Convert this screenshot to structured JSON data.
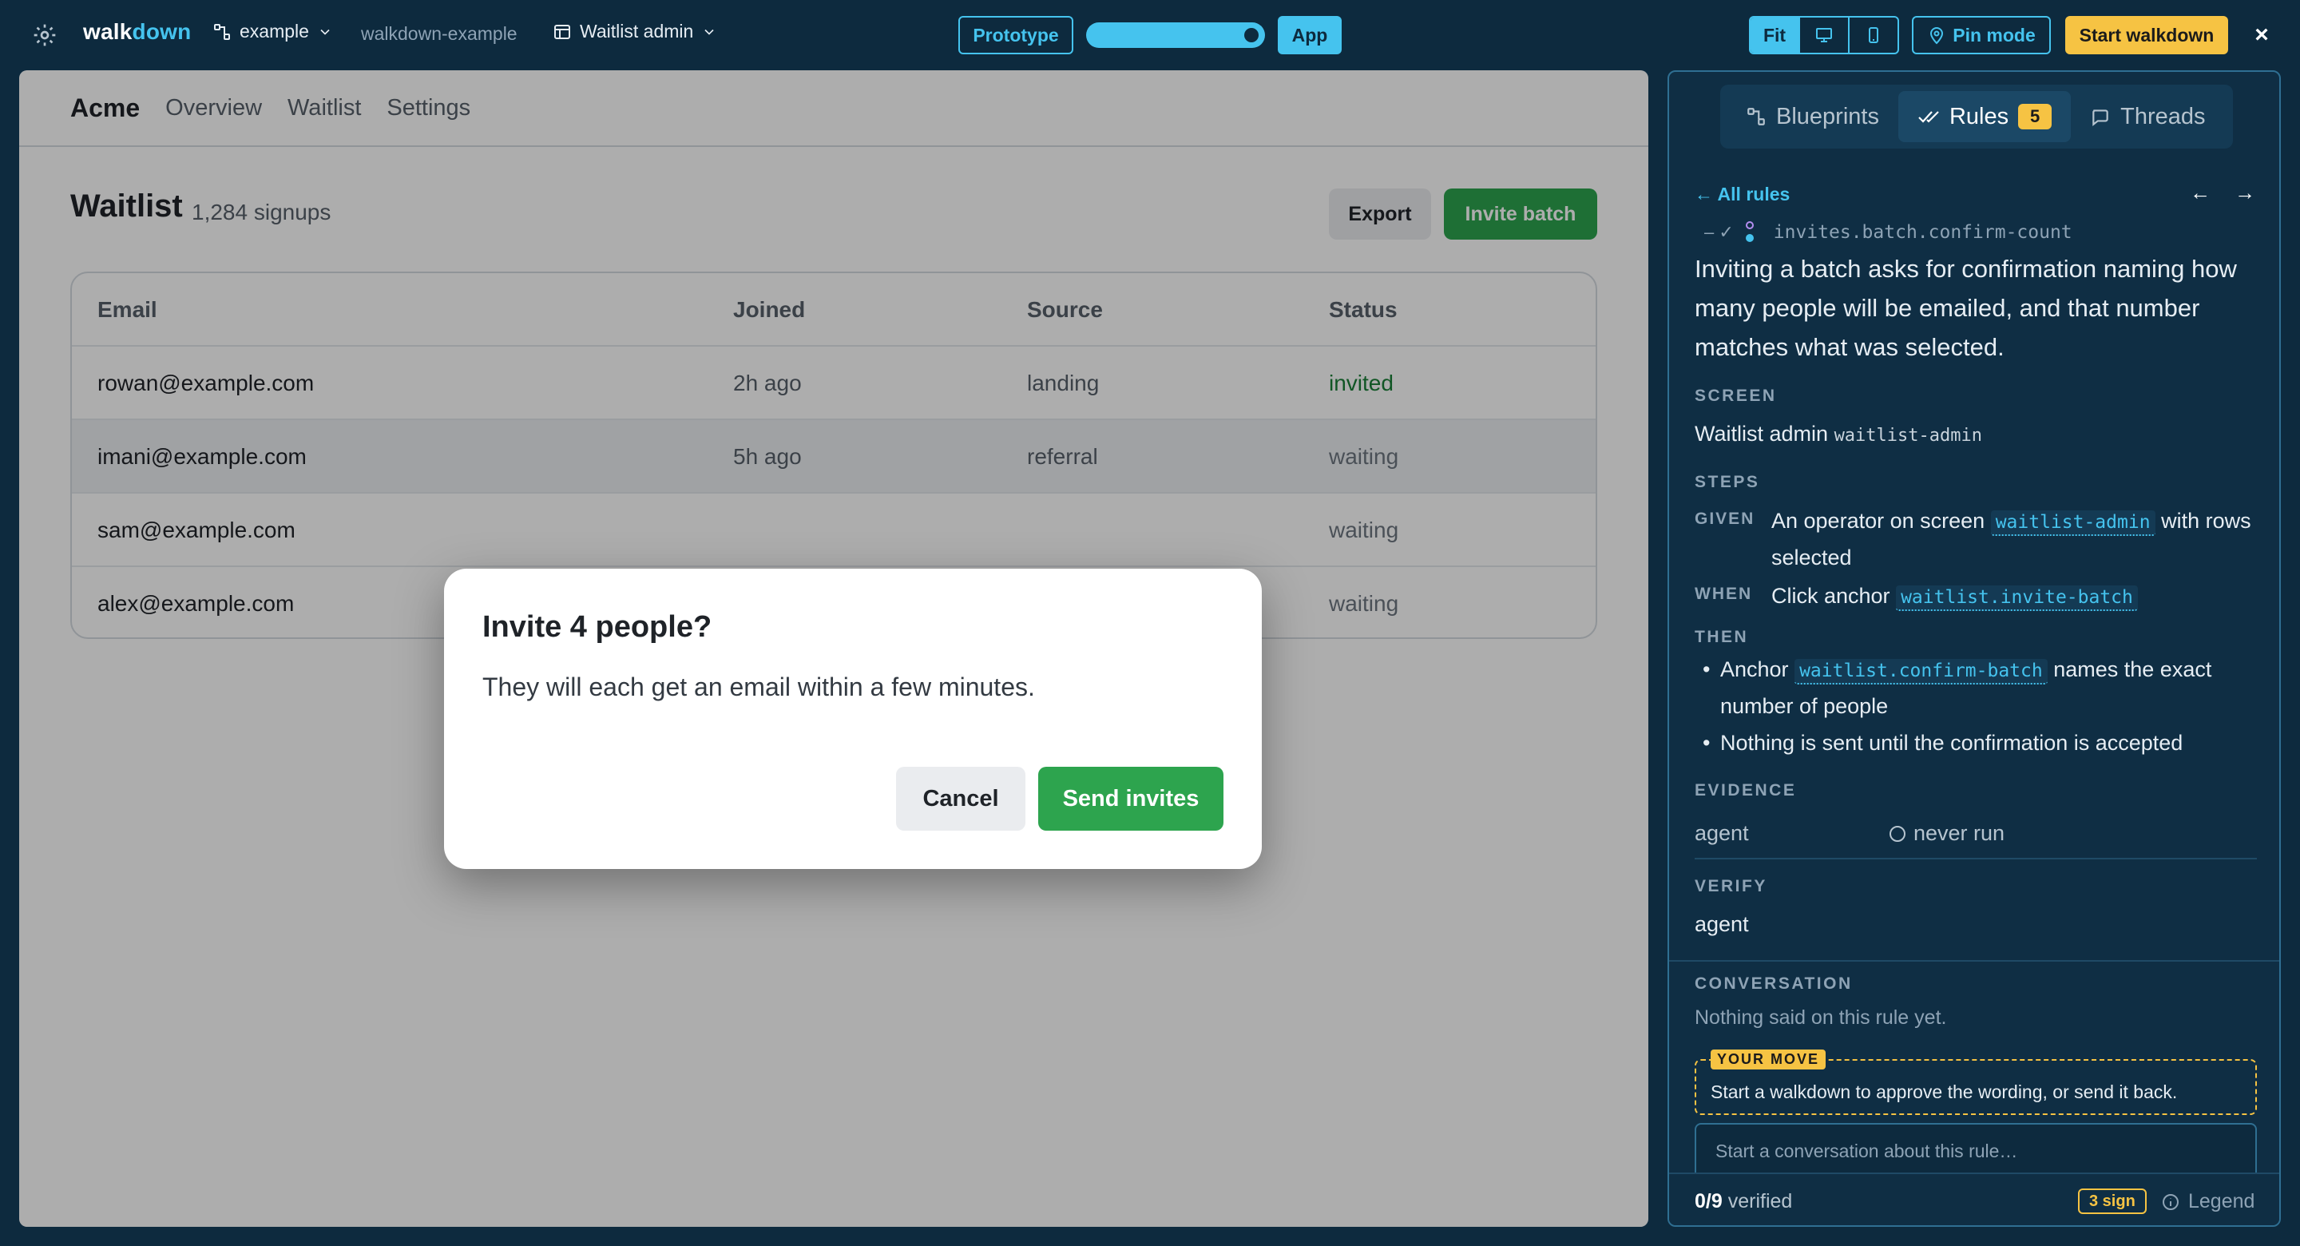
{
  "topbar": {
    "logo_a": "walk",
    "logo_b": "down",
    "project": "example",
    "repo": "walkdown-example",
    "screen": "Waitlist admin",
    "prototype_label": "Prototype",
    "app_label": "App",
    "fit_label": "Fit",
    "pin_label": "Pin mode",
    "start_label": "Start walkdown",
    "close_label": "×",
    "accent_color": "#45c3ee",
    "start_color": "#f6c343"
  },
  "app": {
    "brand": "Acme",
    "nav": [
      "Overview",
      "Waitlist",
      "Settings"
    ],
    "title": "Waitlist",
    "count": "1,284 signups",
    "export_label": "Export",
    "invite_label": "Invite batch",
    "table": {
      "headers": [
        "Email",
        "Joined",
        "Source",
        "Status"
      ],
      "rows": [
        {
          "email": "rowan@example.com",
          "joined": "2h ago",
          "source": "landing",
          "status": "invited"
        },
        {
          "email": "imani@example.com",
          "joined": "5h ago",
          "source": "referral",
          "status": "waiting"
        },
        {
          "email": "sam@example.com",
          "joined": "",
          "source": "",
          "status": "waiting"
        },
        {
          "email": "alex@example.com",
          "joined": "",
          "source": "",
          "status": "waiting"
        }
      ]
    }
  },
  "modal": {
    "title": "Invite 4 people?",
    "body": "They will each get an email within a few minutes.",
    "cancel_label": "Cancel",
    "send_label": "Send invites"
  },
  "panel": {
    "tabs": [
      {
        "label": "Blueprints"
      },
      {
        "label": "Rules",
        "badge": "5"
      },
      {
        "label": "Threads"
      }
    ],
    "back_label": "← All rules",
    "prev_label": "←",
    "next_label": "→",
    "id_marks": "– ✓",
    "rule_id": "invites.batch.confirm-count",
    "rule_text": "Inviting a batch asks for confirmation naming how many people will be emailed, and that number matches what was selected.",
    "screen_heading": "SCREEN",
    "screen_name": "Waitlist admin",
    "screen_code": "waitlist-admin",
    "steps_heading": "STEPS",
    "given_kw": "GIVEN",
    "given_pre": "An operator on screen",
    "given_anchor": "waitlist-admin",
    "given_post": "with rows selected",
    "when_kw": "WHEN",
    "when_pre": "Click anchor",
    "when_anchor": "waitlist.invite-batch",
    "then_kw": "THEN",
    "then_1_pre": "Anchor",
    "then_1_anchor": "waitlist.confirm-batch",
    "then_1_post": "names the exact number of people",
    "then_2": "Nothing is sent until the confirmation is accepted",
    "evidence_heading": "EVIDENCE",
    "evidence_agent": "agent",
    "evidence_status": "never run",
    "verify_heading": "VERIFY",
    "verify_value": "agent",
    "conversation_heading": "CONVERSATION",
    "conversation_empty": "Nothing said on this rule yet.",
    "your_move_badge": "YOUR MOVE",
    "your_move_text": "Start a walkdown to approve the wording, or send it back.",
    "input_placeholder": "Start a conversation about this rule…",
    "footer_verified_count": "0/9",
    "footer_verified_label": " verified",
    "footer_sign": "3 sign",
    "footer_legend": "Legend"
  }
}
